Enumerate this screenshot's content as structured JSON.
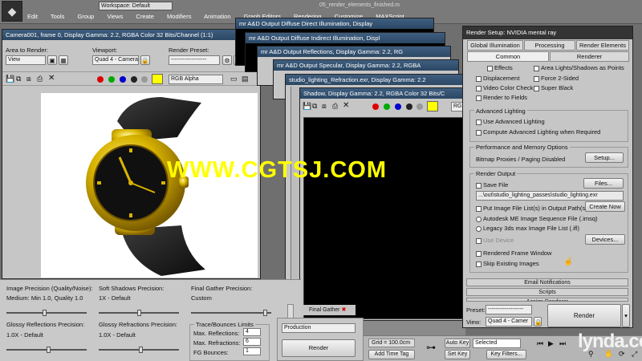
{
  "menubar": {
    "workspace_label": "Workspace: Default",
    "file_title": "05_render_elements_finished.m",
    "items": [
      "Edit",
      "Tools",
      "Group",
      "Views",
      "Create",
      "Modifiers",
      "Animation",
      "Graph Editors",
      "Rendering",
      "Customize",
      "MAXScript"
    ]
  },
  "camera_window": {
    "title": "Camera001, frame 0, Display Gamma: 2.2, RGBA Color 32 Bits/Channel (1:1)",
    "area_label": "Area to Render:",
    "area_value": "View",
    "viewport_label": "Viewport:",
    "viewport_value": "Quad 4 - Camera0",
    "preset_label": "Render Preset:",
    "preset_value": "-------------------",
    "channel": "RGB Alpha"
  },
  "stack_titles": [
    "mr A&D Output Diffuse Direct Illumination, Display",
    "mr A&D Output Diffuse Indirect Illumination, Displ",
    "mr A&D Output Reflections, Display Gamma: 2.2, RG",
    "mr A&D Output Specular, Display Gamma: 2.2, RGBA",
    "studio_lighting_Refraction.exr, Display Gamma: 2.2"
  ],
  "shadow_window": {
    "title": "Shadow, Display Gamma: 2.2, RGBA Color 32 Bits/C",
    "channel": "RGB Alpha"
  },
  "watermark": "WWW.CGTSJ.COM",
  "render_setup": {
    "title": "Render Setup: NVIDIA mental ray",
    "tabs_row1": [
      "Global Illumination",
      "Processing",
      "Render Elements"
    ],
    "tabs_row2": [
      "Common",
      "Renderer"
    ],
    "options": {
      "effects": "Effects",
      "area_lights": "Area Lights/Shadows as Points",
      "displacement": "Displacement",
      "force_2sided": "Force 2-Sided",
      "color_check": "Video Color Check",
      "super_black": "Super Black",
      "render_fields": "Render to Fields"
    },
    "adv_lighting_header": "Advanced Lighting",
    "use_adv": "Use Advanced Lighting",
    "compute_adv": "Compute Advanced Lighting when Required",
    "perf_header": "Performance and Memory Options",
    "bitmap_paging": "Bitmap Proxies / Paging Disabled",
    "setup_btn": "Setup...",
    "output_header": "Render Output",
    "save_file": "Save File",
    "files_btn": "Files...",
    "output_path": "...\\out\\studio_lighting_passes\\studio_lighting.exr",
    "put_image": "Put Image File List(s) in Output Path(s)",
    "create_now": "Create Now",
    "autodesk_seq": "Autodesk ME Image Sequence File (.imsq)",
    "legacy_ifl": "Legacy 3ds max Image File List (.ifl)",
    "use_device": "Use Device",
    "devices_btn": "Devices...",
    "frame_window": "Rendered Frame Window",
    "skip_existing": "Skip Existing Images",
    "email": "Email Notifications",
    "scripts": "Scripts",
    "assign_renderer": "Assign Renderer",
    "preset_label": "Preset:",
    "preset_value": "-------------------",
    "view_label": "View:",
    "view_value": "Quad 4 - Camer",
    "render_btn": "Render"
  },
  "bottom_panel": {
    "img_precision_label": "Image Precision (Quality/Noise):",
    "img_precision_value": "Medium: Min 1.0, Quality 1.0",
    "soft_shadows_label": "Soft Shadows Precision:",
    "soft_shadows_value": "1X - Default",
    "final_gather_label": "Final Gather Precision:",
    "final_gather_value": "Custom",
    "glossy_refl_label": "Glossy Reflections Precision:",
    "glossy_refl_value": "1.0X - Default",
    "glossy_refr_label": "Glossy Refractions Precision:",
    "glossy_refr_value": "1.0X - Default",
    "trace_label": "Trace/Bounces Limits",
    "max_refl_label": "Max. Reflections:",
    "max_refl_value": "4",
    "max_refr_label": "Max. Refractions:",
    "max_refr_value": "6",
    "fg_bounces_label": "FG Bounces:",
    "fg_bounces_value": "1",
    "final_gather_chk": "Final Gather",
    "production": "Production",
    "render_btn": "Render"
  },
  "statusbar": {
    "grid": "Grid = 100.0cm",
    "add_time_tag": "Add Time Tag",
    "auto_key": "Auto Key",
    "selected": "Selected",
    "set_key": "Set Key",
    "key_filters": "Key Filters..."
  },
  "branding": "lynda.com",
  "colors": {
    "accent_yellow": "#ffff00",
    "title_blue": "#36577a",
    "watch_gold": "#d9b400"
  }
}
